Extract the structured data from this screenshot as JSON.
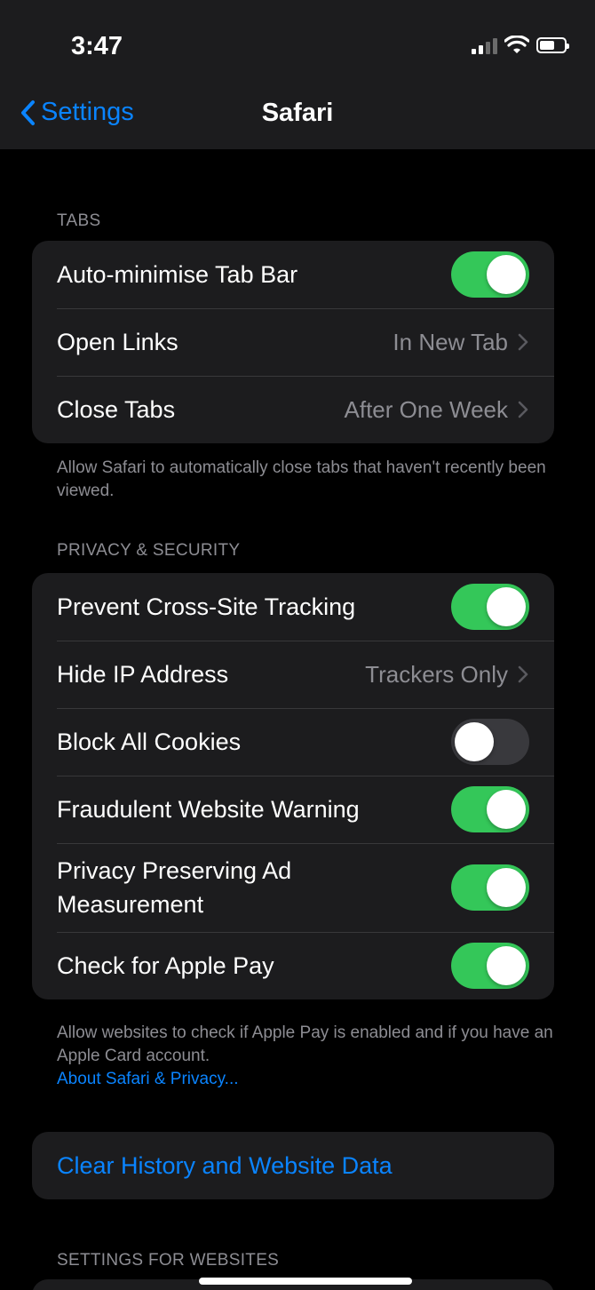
{
  "status_bar": {
    "time": "3:47"
  },
  "nav": {
    "back_label": "Settings",
    "title": "Safari"
  },
  "tabs_section": {
    "header": "TABS",
    "rows": [
      {
        "label": "Auto-minimise Tab Bar",
        "toggle": true
      },
      {
        "label": "Open Links",
        "value": "In New Tab"
      },
      {
        "label": "Close Tabs",
        "value": "After One Week"
      }
    ],
    "footer": "Allow Safari to automatically close tabs that haven't recently been viewed."
  },
  "privacy_section": {
    "header": "PRIVACY & SECURITY",
    "rows": [
      {
        "label": "Prevent Cross-Site Tracking",
        "toggle": true
      },
      {
        "label": "Hide IP Address",
        "value": "Trackers Only"
      },
      {
        "label": "Block All Cookies",
        "toggle": false
      },
      {
        "label": "Fraudulent Website Warning",
        "toggle": true
      },
      {
        "label_line1": "Privacy Preserving Ad",
        "label_line2": "Measurement",
        "toggle": true
      },
      {
        "label": "Check for Apple Pay",
        "toggle": true
      }
    ],
    "footer": "Allow websites to check if Apple Pay is enabled and if you have an Apple Card account.",
    "footer_link": "About Safari & Privacy..."
  },
  "actions": {
    "clear_history": "Clear History and Website Data"
  },
  "websites_section": {
    "header": "SETTINGS FOR WEBSITES"
  },
  "colors": {
    "accent": "#0a84ff",
    "toggle_on": "#34c759",
    "toggle_off": "#39393d",
    "group_bg": "#1c1c1e"
  }
}
